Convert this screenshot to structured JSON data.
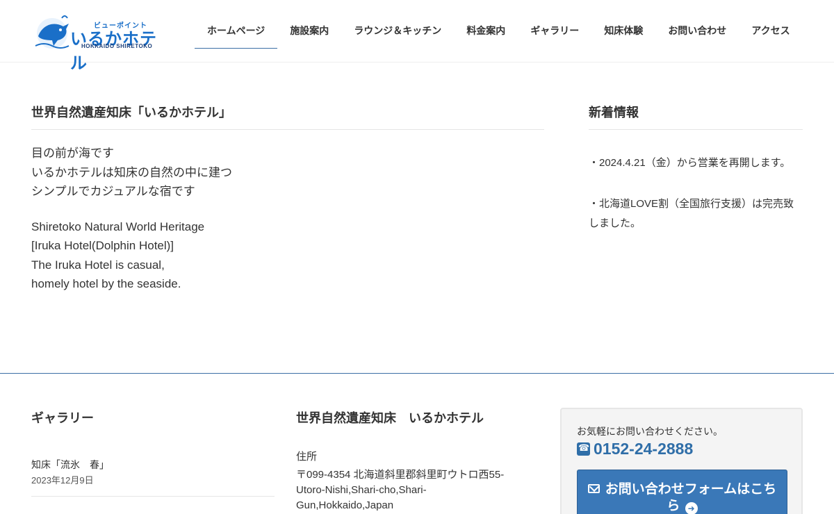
{
  "site": {
    "logo_small": "ビューポイント",
    "logo_big": "いるかホテル",
    "logo_en": "HOKKAIDO SHIRETOKO"
  },
  "nav": {
    "items": [
      {
        "label": "ホームページ",
        "active": true
      },
      {
        "label": "施設案内"
      },
      {
        "label": "ラウンジ＆キッチン"
      },
      {
        "label": "料金案内"
      },
      {
        "label": "ギャラリー"
      },
      {
        "label": "知床体験"
      },
      {
        "label": "お問い合わせ"
      },
      {
        "label": "アクセス"
      }
    ]
  },
  "main": {
    "title": "世界自然遺産知床「いるかホテル」",
    "jp_lines": [
      "目の前が海です",
      "いるかホテルは知床の自然の中に建つ",
      "シンプルでカジュアルな宿です"
    ],
    "en_lines": [
      "Shiretoko Natural World Heritage",
      "[Iruka Hotel(Dolphin Hotel)]",
      "The Iruka Hotel is casual,",
      "homely hotel by the seaside."
    ]
  },
  "sidebar": {
    "title": "新着情報",
    "news": [
      "・2024.4.21（金）から営業を再開します。",
      "・北海道LOVE割（全国旅行支援）は完売致しました。"
    ]
  },
  "footer": {
    "gallery": {
      "title": "ギャラリー",
      "items": [
        {
          "title": "知床「流氷　春」",
          "date": "2023年12月9日"
        }
      ]
    },
    "hotel": {
      "title": "世界自然遺産知床　いるかホテル",
      "address_label": "住所",
      "address": "〒099-4354 北海道斜里郡斜里町ウトロ西55-Utoro-Nishi,Shari-cho,Shari-Gun,Hokkaido,Japan"
    },
    "contact": {
      "lead": "お気軽にお問い合わせください。",
      "phone": "0152-24-2888",
      "button_label": "お問い合わせフォームはこちら"
    }
  },
  "colors": {
    "accent": "#3a78b8",
    "logo": "#1a6fc8",
    "divider": "#3b6ea5"
  }
}
